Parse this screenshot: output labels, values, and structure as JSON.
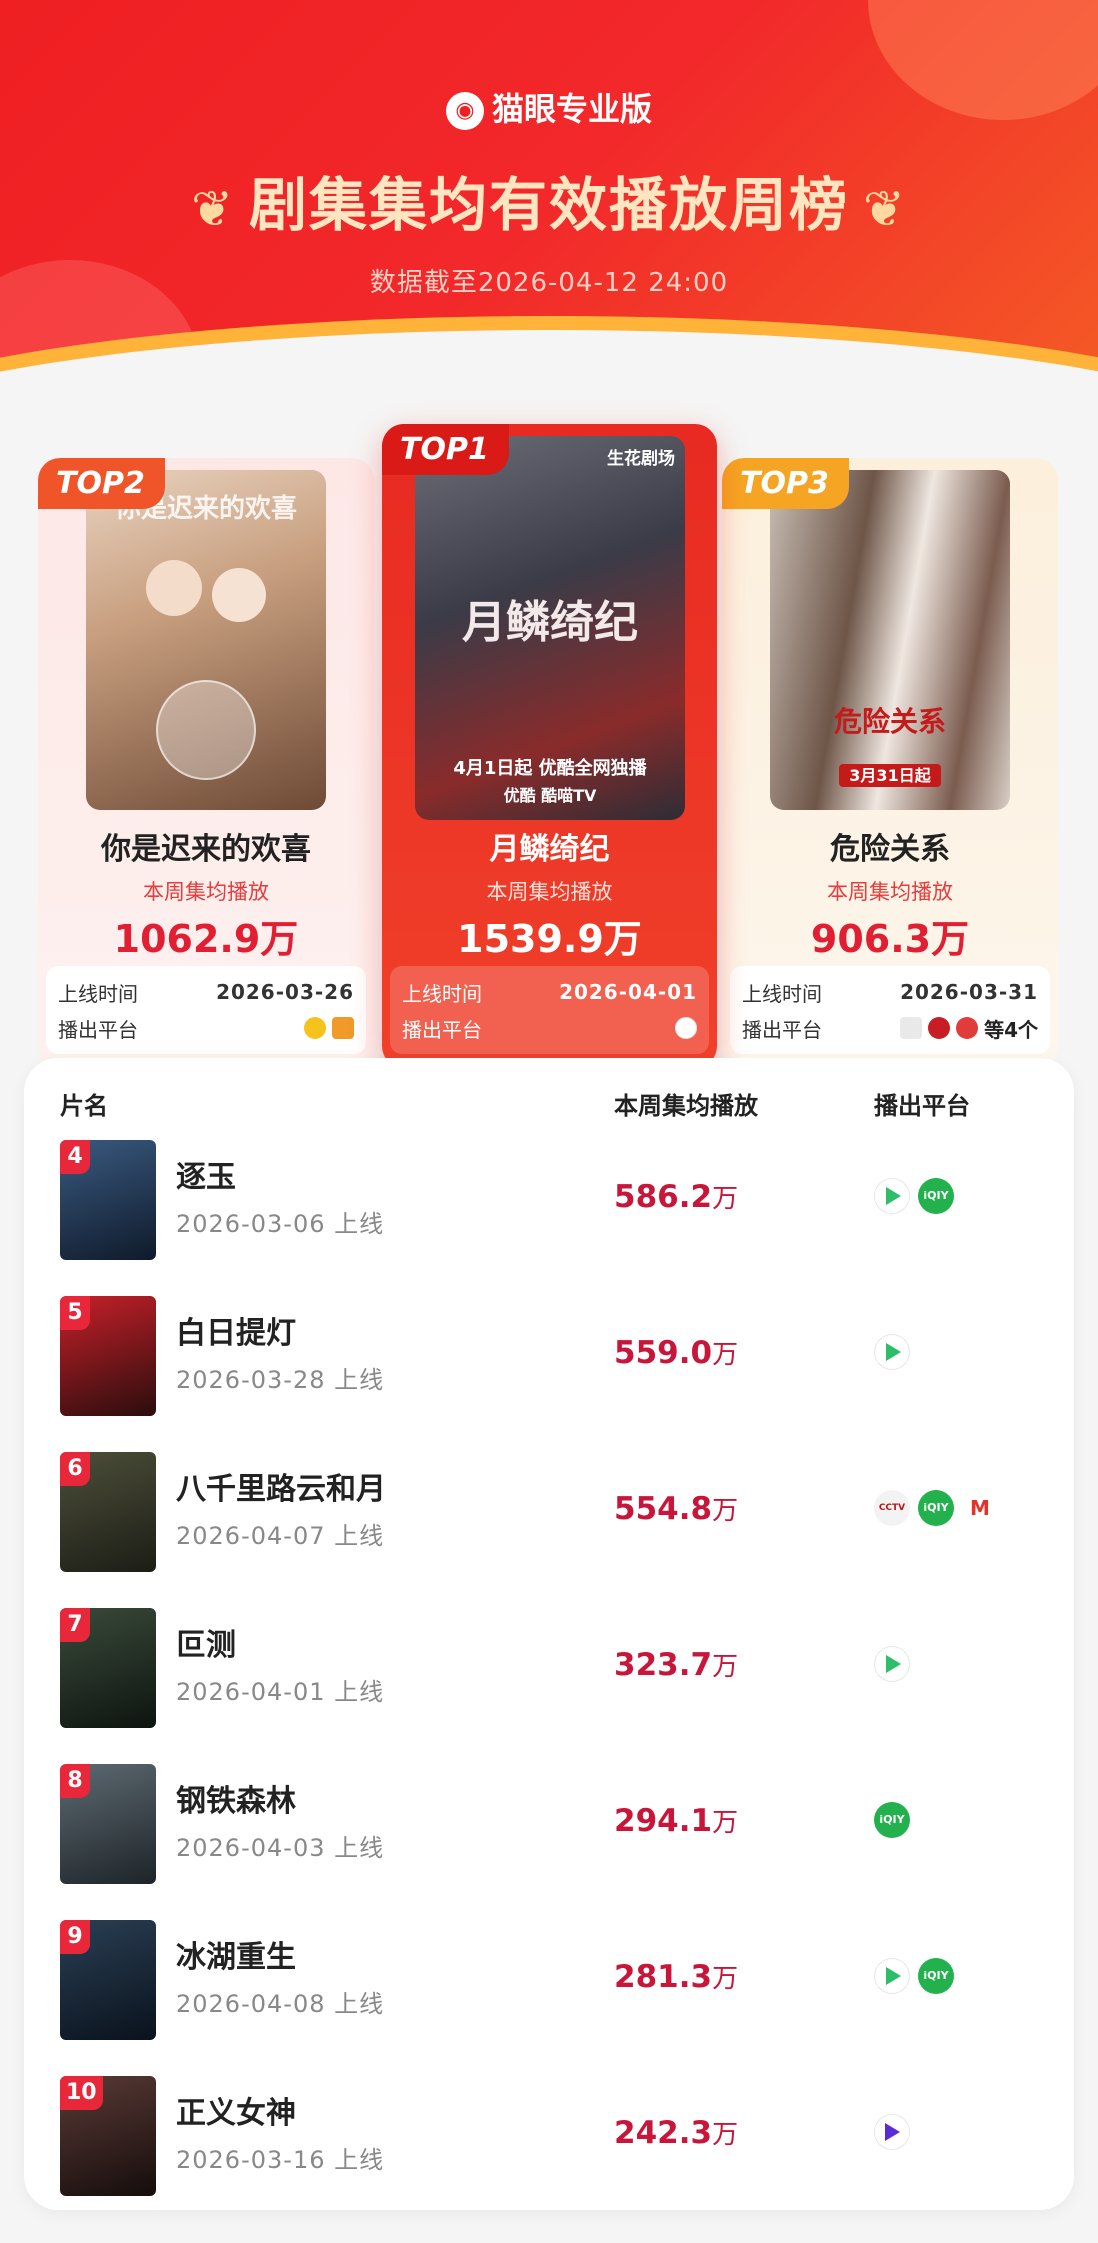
{
  "header": {
    "brand": "猫眼专业版",
    "title": "剧集集均有效播放周榜",
    "as_of": "数据截至2026-04-12 24:00"
  },
  "colors": {
    "accent": "#e8283a",
    "header": "#ef1f22",
    "value": "#c8163a"
  },
  "podium": {
    "top1": {
      "rank": "TOP1",
      "name": "月鳞绮纪",
      "sub": "本周集均播放",
      "value": "1539.9万",
      "online_label": "上线时间",
      "online": "2026-04-01",
      "platform_label": "播出平台",
      "poster_badge": "生花剧场",
      "poster_text": "月鳞绮纪",
      "poster_caption": "4月1日起 优酷全网独播",
      "poster_platforms": "优酷  酷喵TV",
      "platforms": [
        "youku-icon"
      ]
    },
    "top2": {
      "rank": "TOP2",
      "name": "你是迟来的欢喜",
      "sub": "本周集均播放",
      "value": "1062.9万",
      "online_label": "上线时间",
      "online": "2026-03-26",
      "platform_label": "播出平台",
      "poster_text": "你是迟来的欢喜",
      "platforms": [
        "mango-icon",
        "tencent-icon"
      ]
    },
    "top3": {
      "rank": "TOP3",
      "name": "危险关系",
      "sub": "本周集均播放",
      "value": "906.3万",
      "online_label": "上线时间",
      "online": "2026-03-31",
      "platform_label": "播出平台",
      "poster_text": "危险关系",
      "poster_caption": "3月31日起",
      "platforms": [
        "cctv-icon",
        "migu-icon",
        "iqiyi-icon"
      ],
      "platform_more": "等4个"
    }
  },
  "list": {
    "col_name": "片名",
    "col_value": "本周集均播放",
    "col_platform": "播出平台",
    "unit": "万",
    "rows": [
      {
        "rank": "4",
        "name": "逐玉",
        "date": "2026-03-06 上线",
        "value": "586.2",
        "platforms": [
          "tencent",
          "iqiyi"
        ]
      },
      {
        "rank": "5",
        "name": "白日提灯",
        "date": "2026-03-28 上线",
        "value": "559.0",
        "platforms": [
          "tencent"
        ]
      },
      {
        "rank": "6",
        "name": "八千里路云和月",
        "date": "2026-04-07 上线",
        "value": "554.8",
        "platforms": [
          "cctv",
          "iqiyi",
          "mango"
        ]
      },
      {
        "rank": "7",
        "name": "叵测",
        "date": "2026-04-01 上线",
        "value": "323.7",
        "platforms": [
          "tencent"
        ]
      },
      {
        "rank": "8",
        "name": "钢铁森林",
        "date": "2026-04-03 上线",
        "value": "294.1",
        "platforms": [
          "iqiyi"
        ]
      },
      {
        "rank": "9",
        "name": "冰湖重生",
        "date": "2026-04-08 上线",
        "value": "281.3",
        "platforms": [
          "tencent",
          "iqiyi"
        ]
      },
      {
        "rank": "10",
        "name": "正义女神",
        "date": "2026-03-16 上线",
        "value": "242.3",
        "platforms": [
          "youku"
        ]
      }
    ]
  }
}
